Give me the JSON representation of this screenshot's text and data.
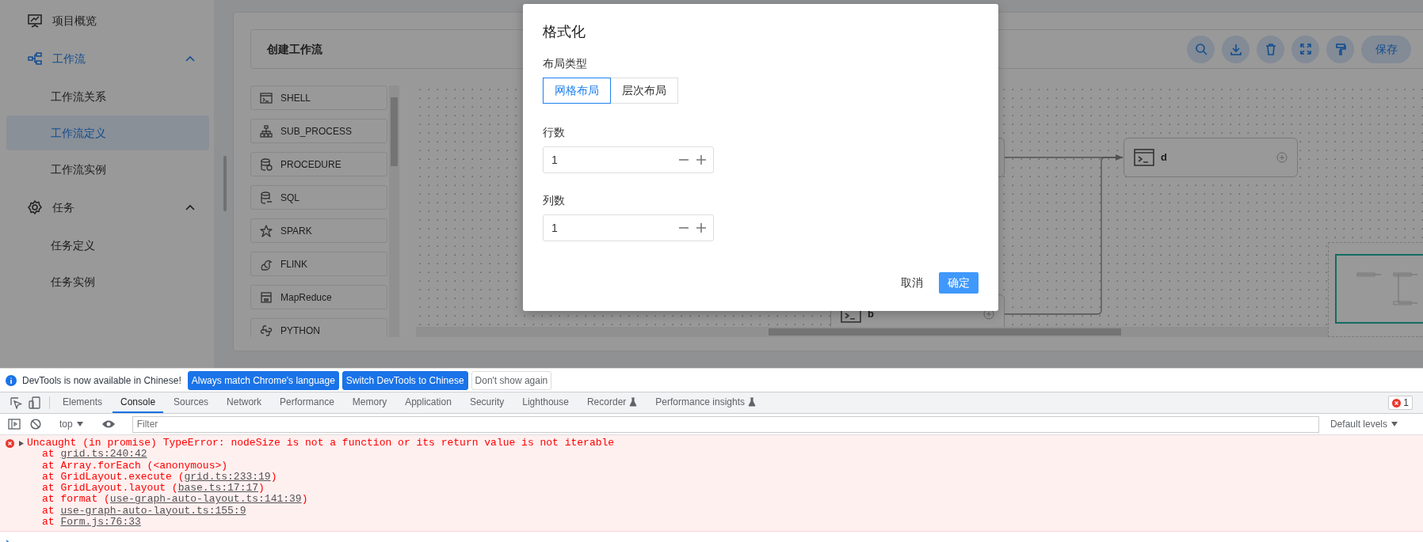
{
  "sidebar": {
    "items": [
      {
        "label": "项目概览"
      },
      {
        "label": "工作流",
        "expanded": true,
        "children": [
          {
            "label": "工作流关系",
            "selected": false
          },
          {
            "label": "工作流定义",
            "selected": true
          },
          {
            "label": "工作流实例",
            "selected": false
          }
        ]
      },
      {
        "label": "任务",
        "expanded": true,
        "children": [
          {
            "label": "任务定义",
            "selected": false
          },
          {
            "label": "任务实例",
            "selected": false
          }
        ]
      }
    ]
  },
  "editor": {
    "title": "创建工作流",
    "save_label": "保存",
    "task_types": [
      "SHELL",
      "SUB_PROCESS",
      "PROCEDURE",
      "SQL",
      "SPARK",
      "FLINK",
      "MapReduce",
      "PYTHON"
    ],
    "nodes": [
      {
        "label": "d"
      },
      {
        "label": "b"
      }
    ]
  },
  "dialog": {
    "title": "格式化",
    "layout_label": "布局类型",
    "layout_options": [
      {
        "label": "网格布局",
        "selected": true
      },
      {
        "label": "层次布局",
        "selected": false
      }
    ],
    "fields": [
      {
        "label": "行数",
        "value": "1"
      },
      {
        "label": "列数",
        "value": "1"
      }
    ],
    "cancel": "取消",
    "confirm": "确定"
  },
  "devtools": {
    "infobar": {
      "message": "DevTools is now available in Chinese!",
      "buttons": [
        {
          "label": "Always match Chrome's language",
          "kind": "primary"
        },
        {
          "label": "Switch DevTools to Chinese",
          "kind": "primary"
        },
        {
          "label": "Don't show again",
          "kind": "plain"
        }
      ]
    },
    "tabs": [
      {
        "label": "Elements",
        "selected": false,
        "experimental": false
      },
      {
        "label": "Console",
        "selected": true,
        "experimental": false
      },
      {
        "label": "Sources",
        "selected": false,
        "experimental": false
      },
      {
        "label": "Network",
        "selected": false,
        "experimental": false
      },
      {
        "label": "Performance",
        "selected": false,
        "experimental": false
      },
      {
        "label": "Memory",
        "selected": false,
        "experimental": false
      },
      {
        "label": "Application",
        "selected": false,
        "experimental": false
      },
      {
        "label": "Security",
        "selected": false,
        "experimental": false
      },
      {
        "label": "Lighthouse",
        "selected": false,
        "experimental": false
      },
      {
        "label": "Recorder",
        "selected": false,
        "experimental": true
      },
      {
        "label": "Performance insights",
        "selected": false,
        "experimental": true
      }
    ],
    "error_count": "1",
    "context": "top",
    "filter_placeholder": "Filter",
    "levels": "Default levels",
    "error": {
      "message": "Uncaught (in promise) TypeError: nodeSize is not a function or its return value is not iterable",
      "stack": [
        {
          "before": "at ",
          "link": "grid.ts:240:42"
        },
        {
          "before": "at Array.forEach (<anonymous>)"
        },
        {
          "before": "at GridLayout.execute (",
          "link": "grid.ts:233:19",
          "after": ")"
        },
        {
          "before": "at GridLayout.layout (",
          "link": "base.ts:17:17",
          "after": ")"
        },
        {
          "before": "at format (",
          "link": "use-graph-auto-layout.ts:141:39",
          "after": ")"
        },
        {
          "before": "at ",
          "link": "use-graph-auto-layout.ts:155:9"
        },
        {
          "before": "at ",
          "link": "Form.js:76:33"
        }
      ]
    }
  }
}
